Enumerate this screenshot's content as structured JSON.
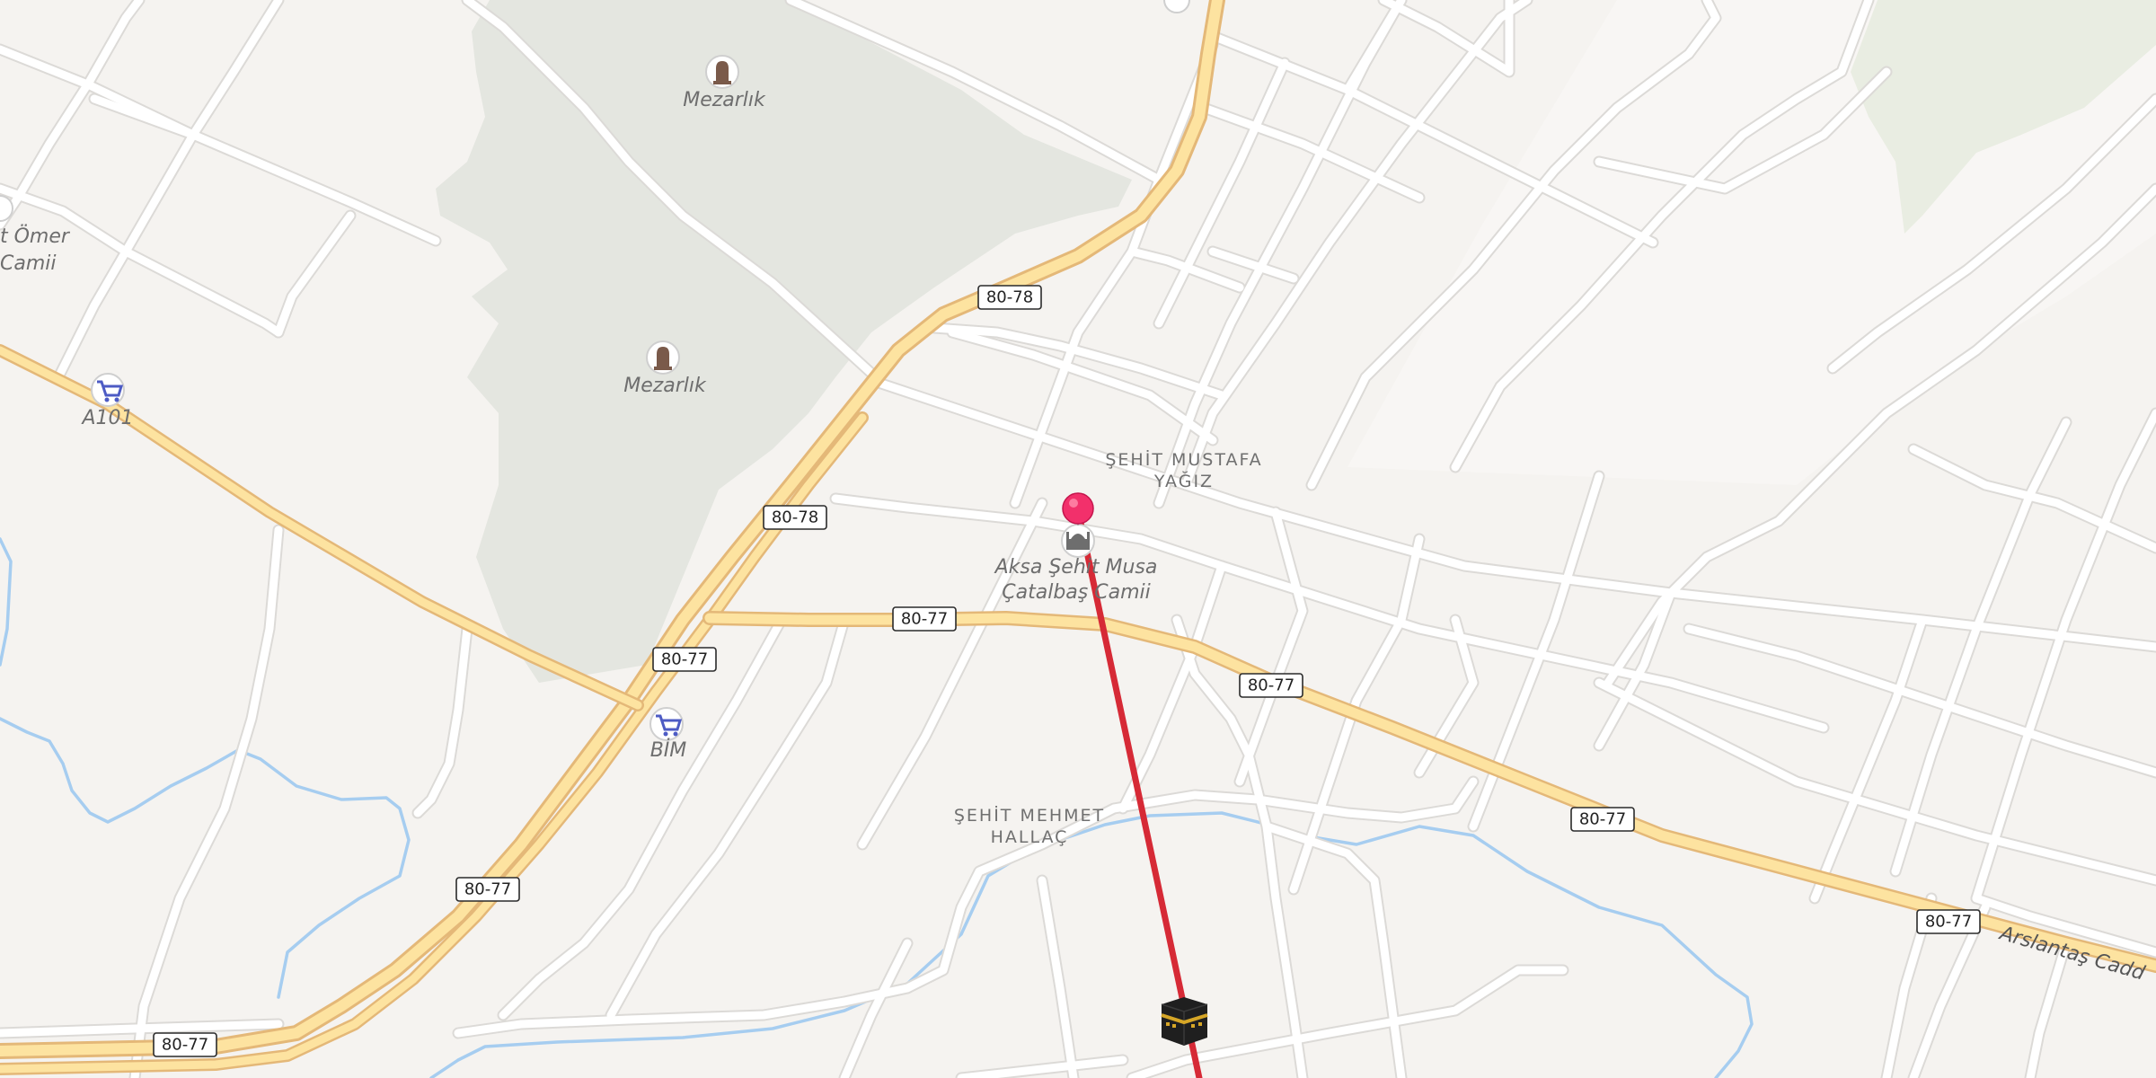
{
  "map": {
    "accent_route_color": "#d62a36",
    "pin_color": "#f2306b",
    "park_color": "#e4e6e0",
    "road_shields": [
      {
        "id": "shield-80-78-a",
        "label": "80-78"
      },
      {
        "id": "shield-80-78-b",
        "label": "80-78"
      },
      {
        "id": "shield-80-77-a",
        "label": "80-77"
      },
      {
        "id": "shield-80-77-b",
        "label": "80-77"
      },
      {
        "id": "shield-80-77-c",
        "label": "80-77"
      },
      {
        "id": "shield-80-77-d",
        "label": "80-77"
      },
      {
        "id": "shield-80-77-e",
        "label": "80-77"
      },
      {
        "id": "shield-80-77-f",
        "label": "80-77"
      },
      {
        "id": "shield-80-77-g",
        "label": "80-77"
      }
    ],
    "poi": {
      "cemetery_1": {
        "name": "Mezarlık",
        "icon": "tombstone-icon"
      },
      "cemetery_2": {
        "name": "Mezarlık",
        "icon": "tombstone-icon"
      },
      "mosque_left_line1": "t Ömer",
      "mosque_left_line2": "Camii",
      "market_a101": {
        "name": "A101",
        "icon": "shopping-cart-icon"
      },
      "market_bim": {
        "name": "BİM",
        "icon": "shopping-cart-icon"
      },
      "mosque_main_line1": "Aksa Şehit Musa",
      "mosque_main_line2": "Çatalbaş Camii",
      "mosque_main_icon": "mosque-icon"
    },
    "districts": {
      "sehit_mustafa_line1": "ŞEHİT MUSTAFA",
      "sehit_mustafa_line2": "YAĞIZ",
      "sehit_mehmet_line1": "ŞEHİT MEHMET",
      "sehit_mehmet_line2": "HALLAÇ"
    },
    "street_label": "Arslantaş Cadd",
    "markers": {
      "location_pin": "location-pin-icon",
      "kaaba": "kaaba-icon",
      "qibla_line": "qibla-direction-line"
    }
  }
}
